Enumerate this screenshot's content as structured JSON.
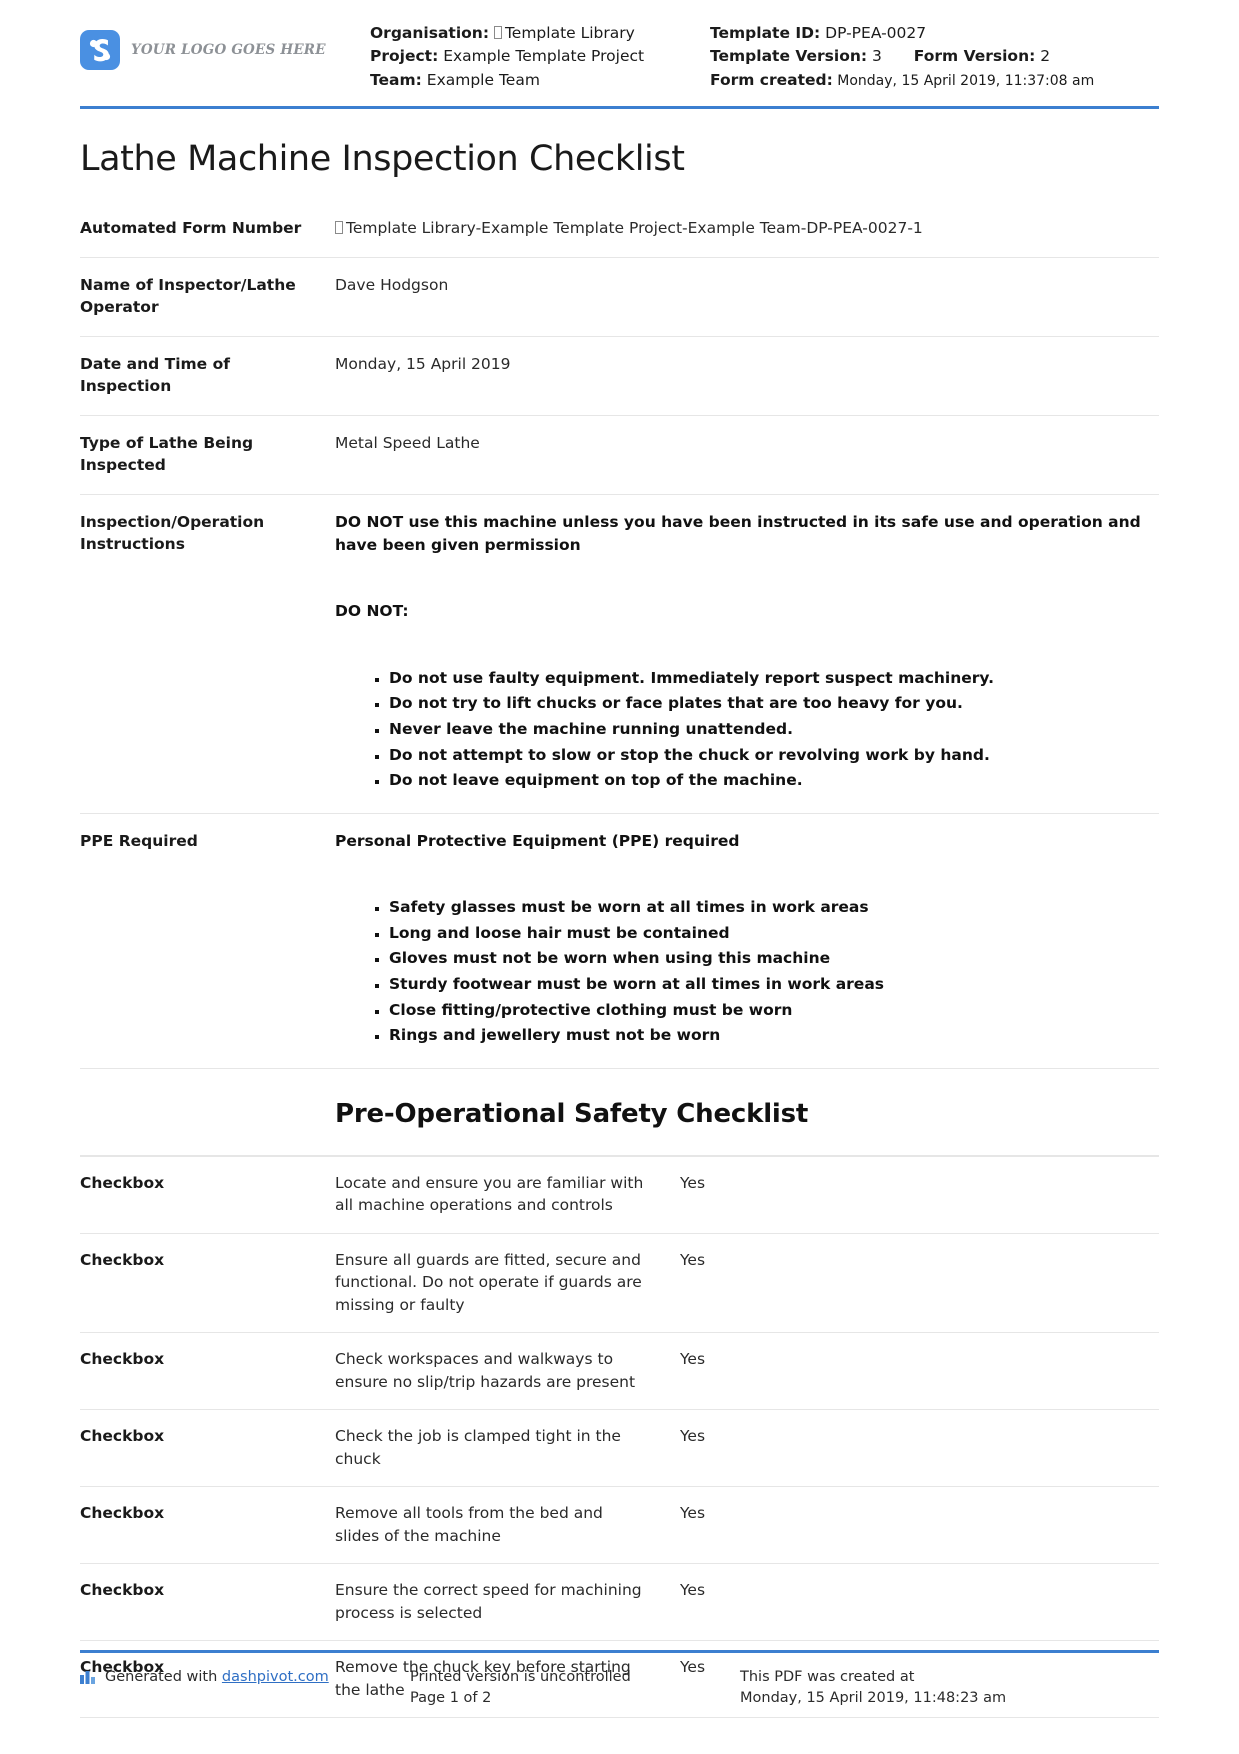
{
  "header": {
    "logo_text": "YOUR LOGO GOES HERE",
    "organisation_label": "Organisation:",
    "organisation_value": "Template Library",
    "project_label": "Project:",
    "project_value": "Example Template Project",
    "team_label": "Team:",
    "team_value": "Example Team",
    "template_id_label": "Template ID:",
    "template_id_value": "DP-PEA-0027",
    "template_version_label": "Template Version:",
    "template_version_value": "3",
    "form_version_label": "Form Version:",
    "form_version_value": "2",
    "form_created_label": "Form created:",
    "form_created_value": "Monday, 15 April 2019, 11:37:08 am"
  },
  "title": "Lathe Machine Inspection Checklist",
  "fields": {
    "automated_form_number_label": "Automated Form Number",
    "automated_form_number_value": "Template Library-Example Template Project-Example Team-DP-PEA-0027-1",
    "inspector_label": "Name of Inspector/Lathe Operator",
    "inspector_value": "Dave Hodgson",
    "date_time_label": "Date and Time of Inspection",
    "date_time_value": "Monday, 15 April 2019",
    "lathe_type_label": "Type of Lathe Being Inspected",
    "lathe_type_value": "Metal Speed Lathe",
    "instructions_label": "Inspection/Operation Instructions",
    "instructions_heading": "DO NOT use this machine unless you have been instructed in its safe use and operation and have been given permission",
    "instructions_subheading": "DO NOT:",
    "instructions_items": [
      "Do not use faulty equipment. Immediately report suspect machinery.",
      "Do not try to lift chucks or face plates that are too heavy for you.",
      "Never leave the machine running unattended.",
      "Do not attempt to slow or stop the chuck or revolving work by hand.",
      "Do not leave equipment on top of the machine."
    ],
    "ppe_label": "PPE Required",
    "ppe_heading": "Personal Protective Equipment (PPE) required",
    "ppe_items": [
      "Safety glasses must be worn at all times in work areas",
      "Long and loose hair must be contained",
      "Gloves must not be worn when using this machine",
      "Sturdy footwear must be worn at all times in work areas",
      "Close fitting/protective clothing must be worn",
      "Rings and jewellery must not be worn"
    ]
  },
  "checklist": {
    "section_heading": "Pre-Operational Safety Checklist",
    "rows": [
      {
        "label": "Checkbox",
        "description": "Locate and ensure you are familiar with all machine operations and controls",
        "value": "Yes"
      },
      {
        "label": "Checkbox",
        "description": "Ensure all guards are fitted, secure and functional. Do not operate if guards are missing or faulty",
        "value": "Yes"
      },
      {
        "label": "Checkbox",
        "description": "Check workspaces and walkways to ensure no slip/trip hazards are present",
        "value": "Yes"
      },
      {
        "label": "Checkbox",
        "description": "Check the job is clamped tight in the chuck",
        "value": "Yes"
      },
      {
        "label": "Checkbox",
        "description": "Remove all tools from the bed and slides of the machine",
        "value": "Yes"
      },
      {
        "label": "Checkbox",
        "description": "Ensure the correct speed for machining process is selected",
        "value": "Yes"
      },
      {
        "label": "Checkbox",
        "description": "Remove the chuck key before starting the lathe",
        "value": "Yes"
      }
    ]
  },
  "footer": {
    "generated_prefix": "Generated with",
    "generated_link": "dashpivot.com",
    "printed_notice": "Printed version is uncontrolled",
    "page_number": "Page 1 of 2",
    "created_notice": "This PDF was created at",
    "created_timestamp": "Monday, 15 April 2019, 11:48:23 am"
  },
  "colors": {
    "accent": "#3c7fd0",
    "logo": "#4a90e2",
    "link": "#2f6fc4"
  }
}
